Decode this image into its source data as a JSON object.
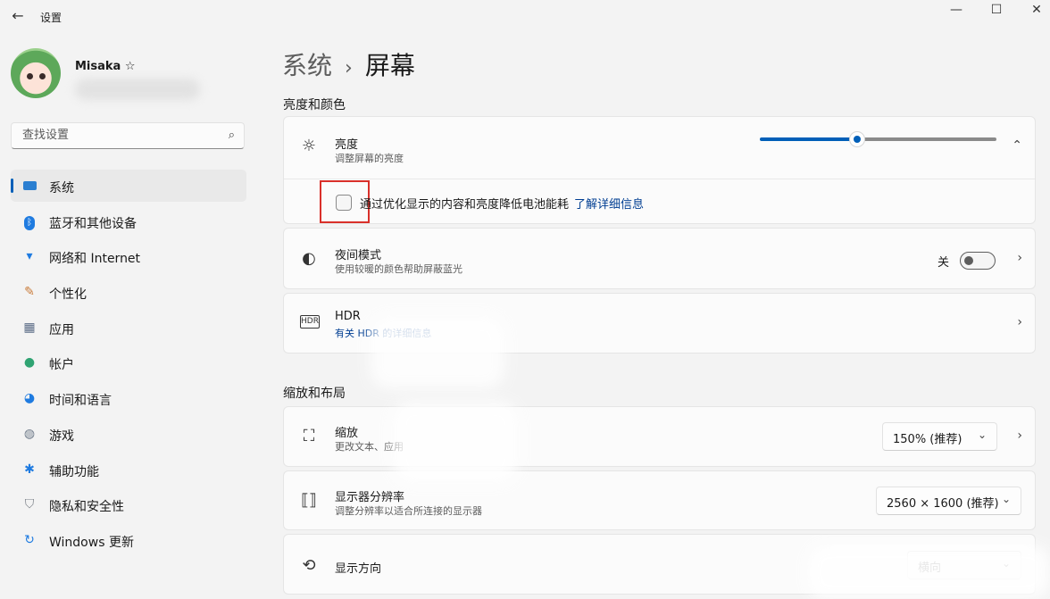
{
  "window": {
    "title": "设置",
    "back_icon": "back-arrow-icon",
    "minimize": "—",
    "maximize": "☐",
    "close": "✕"
  },
  "user": {
    "name": "Misaka ☆"
  },
  "search": {
    "placeholder": "查找设置",
    "icon": "search-icon"
  },
  "sidebar": {
    "items": [
      {
        "label": "系统",
        "icon": "system-icon",
        "active": true
      },
      {
        "label": "蓝牙和其他设备",
        "icon": "bluetooth-icon"
      },
      {
        "label": "网络和 Internet",
        "icon": "wifi-icon"
      },
      {
        "label": "个性化",
        "icon": "brush-icon"
      },
      {
        "label": "应用",
        "icon": "apps-icon"
      },
      {
        "label": "帐户",
        "icon": "account-icon"
      },
      {
        "label": "时间和语言",
        "icon": "globe-clock-icon"
      },
      {
        "label": "游戏",
        "icon": "gamepad-icon"
      },
      {
        "label": "辅助功能",
        "icon": "accessibility-icon"
      },
      {
        "label": "隐私和安全性",
        "icon": "shield-icon"
      },
      {
        "label": "Windows 更新",
        "icon": "update-icon"
      }
    ]
  },
  "breadcrumb": {
    "parent": "系统",
    "separator": "›",
    "current": "屏幕"
  },
  "sections": {
    "brightness_color": "亮度和颜色",
    "scale_layout": "缩放和布局"
  },
  "brightness": {
    "title": "亮度",
    "subtitle": "调整屏幕的亮度",
    "level_fraction": 0.41,
    "battery_option": "通过优化显示的内容和亮度降低电池能耗",
    "battery_link": "了解详细信息",
    "checked": false
  },
  "night_light": {
    "title": "夜间模式",
    "subtitle": "使用较暖的颜色帮助屏蔽蓝光",
    "state": "关"
  },
  "hdr": {
    "title": "HDR",
    "subtitle": "有关 HDR 的详细信息"
  },
  "scale": {
    "title": "缩放",
    "subtitle": "更改文本、应用",
    "value": "150% (推荐)"
  },
  "resolution": {
    "title": "显示器分辨率",
    "subtitle": "调整分辨率以适合所连接的显示器",
    "value": "2560 × 1600 (推荐)"
  },
  "orientation": {
    "title": "显示方向",
    "value": "横向"
  },
  "colors": {
    "accent": "#005fb8",
    "highlight": "#d9302a"
  }
}
